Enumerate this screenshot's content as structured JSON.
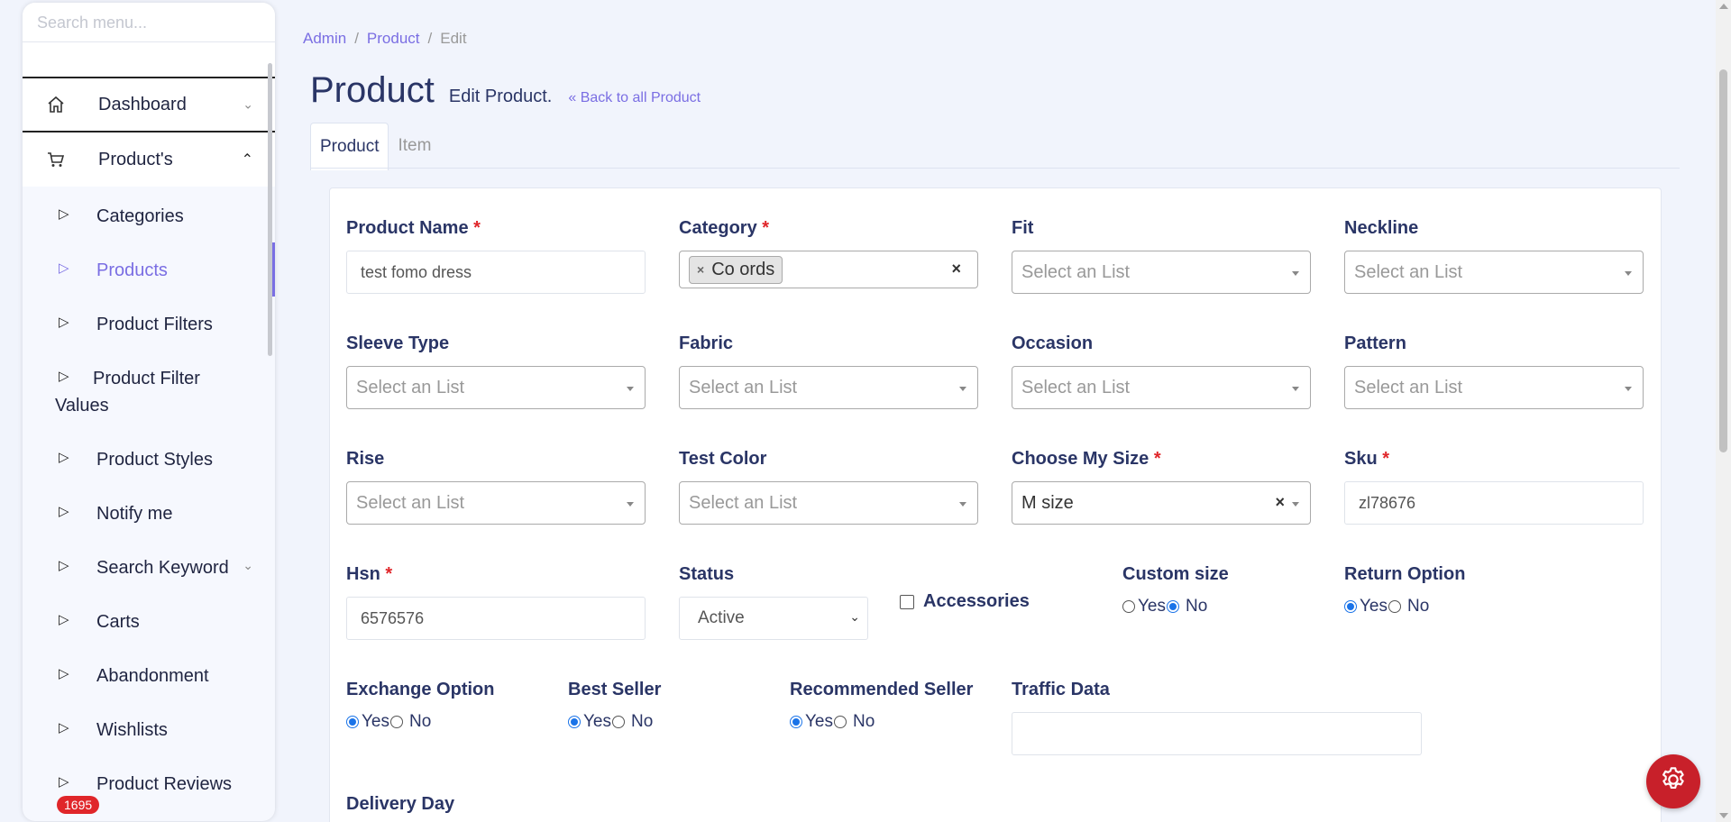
{
  "sidebar": {
    "search_placeholder": "Search menu...",
    "items": [
      {
        "label": "Dashboard"
      },
      {
        "label": "Product's"
      }
    ],
    "sub_items": [
      {
        "label": "Categories"
      },
      {
        "label": "Products"
      },
      {
        "label": "Product Filters"
      },
      {
        "label": "Product Filter Values"
      },
      {
        "label": "Product Styles"
      },
      {
        "label": "Notify me"
      },
      {
        "label": "Search Keyword"
      },
      {
        "label": "Carts"
      },
      {
        "label": "Abandonment"
      },
      {
        "label": "Wishlists"
      },
      {
        "label": "Product Reviews"
      }
    ],
    "badge": "1695"
  },
  "breadcrumb": {
    "a": "Admin",
    "b": "Product",
    "c": "Edit"
  },
  "header": {
    "title": "Product",
    "subtitle": "Edit Product.",
    "back": "Back to all Product"
  },
  "tabs": [
    {
      "label": "Product"
    },
    {
      "label": "Item"
    }
  ],
  "form": {
    "product_name": {
      "label": "Product Name",
      "value": "test fomo dress"
    },
    "category": {
      "label": "Category",
      "chip": "Co ords"
    },
    "fit": {
      "label": "Fit",
      "placeholder": "Select an List"
    },
    "neckline": {
      "label": "Neckline",
      "placeholder": "Select an List"
    },
    "sleeve_type": {
      "label": "Sleeve Type",
      "placeholder": "Select an List"
    },
    "fabric": {
      "label": "Fabric",
      "placeholder": "Select an List"
    },
    "occasion": {
      "label": "Occasion",
      "placeholder": "Select an List"
    },
    "pattern": {
      "label": "Pattern",
      "placeholder": "Select an List"
    },
    "rise": {
      "label": "Rise",
      "placeholder": "Select an List"
    },
    "test_color": {
      "label": "Test Color",
      "placeholder": "Select an List"
    },
    "choose_my_size": {
      "label": "Choose My Size",
      "value": "M size"
    },
    "sku": {
      "label": "Sku",
      "value": "zl78676"
    },
    "hsn": {
      "label": "Hsn",
      "value": "6576576"
    },
    "status": {
      "label": "Status",
      "value": "Active"
    },
    "accessories": {
      "label": "Accessories"
    },
    "custom_size": {
      "label": "Custom size",
      "yes": "Yes",
      "no": "No"
    },
    "return_option": {
      "label": "Return Option",
      "yes": "Yes",
      "no": "No"
    },
    "exchange_option": {
      "label": "Exchange Option",
      "yes": "Yes",
      "no": "No"
    },
    "best_seller": {
      "label": "Best Seller",
      "yes": "Yes",
      "no": "No"
    },
    "recommended_seller": {
      "label": "Recommended Seller",
      "yes": "Yes",
      "no": "No"
    },
    "traffic_data": {
      "label": "Traffic Data",
      "value": ""
    },
    "delivery_day": {
      "label": "Delivery Day"
    },
    "required_mark": "*"
  },
  "colors": {
    "accent": "#7a6ee3",
    "heading": "#2a3566",
    "required": "#e0262a",
    "fab": "#c8202a"
  }
}
